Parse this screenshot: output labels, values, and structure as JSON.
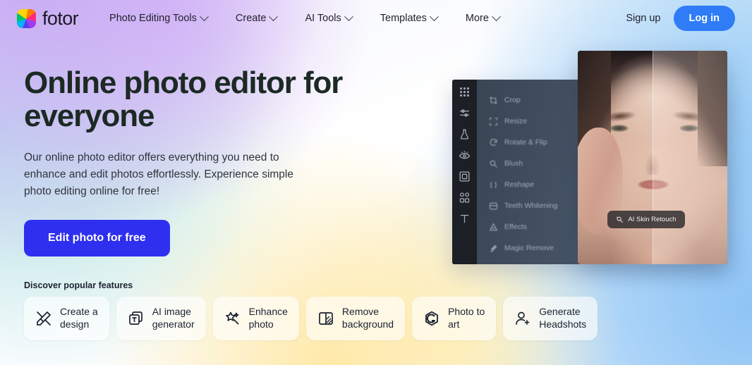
{
  "header": {
    "logo_text": "fotor",
    "logo_icon": "fotor-pinwheel-logo",
    "nav": [
      {
        "label": "Photo Editing Tools",
        "icon": "chevron-down-icon"
      },
      {
        "label": "Create",
        "icon": "chevron-down-icon"
      },
      {
        "label": "AI Tools",
        "icon": "chevron-down-icon"
      },
      {
        "label": "Templates",
        "icon": "chevron-down-icon"
      },
      {
        "label": "More",
        "icon": "chevron-down-icon"
      }
    ],
    "signup_label": "Sign up",
    "login_label": "Log in",
    "login_color": "#2f7cf6"
  },
  "hero": {
    "title": "Online photo editor for\neveryone",
    "subtitle": "Our online photo editor offers everything you need to\nenhance and edit photos effortlessly. Experience simple\nphoto editing online for free!",
    "cta_label": "Edit photo for free",
    "cta_color": "#2f2ff0"
  },
  "features": {
    "title": "Discover popular features",
    "cards": [
      {
        "label": "Create a\ndesign",
        "icon": "pencil-ruler-icon"
      },
      {
        "label": "AI image\ngenerator",
        "icon": "image-stack-icon"
      },
      {
        "label": "Enhance\nphoto",
        "icon": "magic-wand-sparkle-icon"
      },
      {
        "label": "Remove\nbackground",
        "icon": "background-split-icon"
      },
      {
        "label": "Photo to\nart",
        "icon": "hexagon-art-icon"
      },
      {
        "label": "Generate\nHeadshots",
        "icon": "user-plus-icon"
      }
    ]
  },
  "editor_mockup": {
    "rail_icons": [
      "grid-templates-icon",
      "adjust-sliders-icon",
      "beauty-flask-icon",
      "eye-retouch-icon",
      "frame-icon",
      "sticker-icon",
      "text-icon"
    ],
    "menu_items": [
      {
        "label": "Crop",
        "icon": "crop-icon"
      },
      {
        "label": "Resize",
        "icon": "resize-icon"
      },
      {
        "label": "Rotate & Flip",
        "icon": "rotate-icon"
      },
      {
        "label": "Blush",
        "icon": "blush-icon"
      },
      {
        "label": "Reshape",
        "icon": "reshape-icon"
      },
      {
        "label": "Teeth Whitening",
        "icon": "teeth-icon"
      },
      {
        "label": "Effects",
        "icon": "effects-icon"
      },
      {
        "label": "Magic Remove",
        "icon": "magic-remove-icon"
      }
    ],
    "photo_badge": {
      "label": "AI Skin Retouch",
      "icon": "skin-retouch-icon"
    }
  }
}
